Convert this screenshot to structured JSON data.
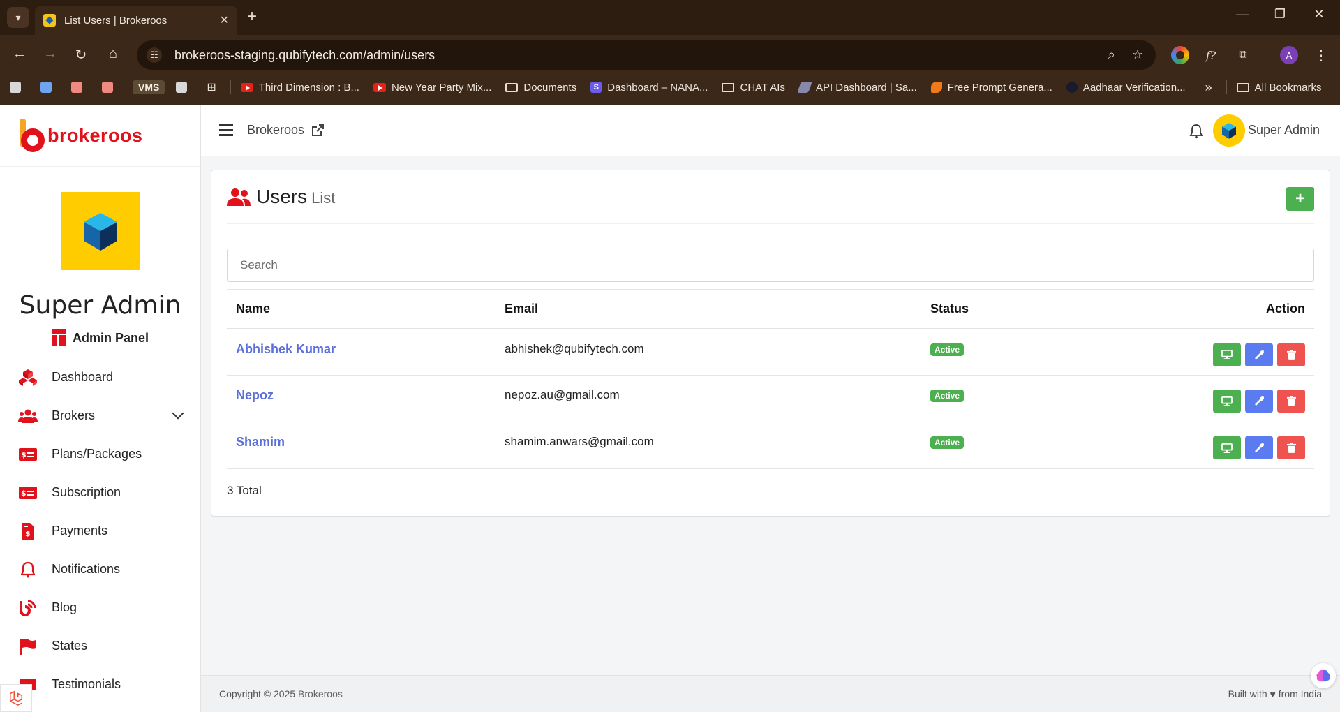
{
  "browser": {
    "tab_title": "List Users | Brokeroos",
    "url": "brokeroos-staging.qubifytech.com/admin/users",
    "profile_initial": "A",
    "bookmarks": [
      {
        "label": "VMS"
      },
      {
        "label": "Third Dimension : B..."
      },
      {
        "label": "New Year Party Mix..."
      },
      {
        "label": "Documents"
      },
      {
        "label": "Dashboard – NANA..."
      },
      {
        "label": "CHAT AIs"
      },
      {
        "label": "API Dashboard | Sa..."
      },
      {
        "label": "Free Prompt Genera..."
      },
      {
        "label": "Aadhaar Verification..."
      },
      {
        "label": "All Bookmarks"
      }
    ]
  },
  "sidebar": {
    "brand": "brokeroos",
    "profile_name": "Super Admin",
    "panel_label": "Admin Panel",
    "items": [
      {
        "label": "Dashboard"
      },
      {
        "label": "Brokers"
      },
      {
        "label": "Plans/Packages"
      },
      {
        "label": "Subscription"
      },
      {
        "label": "Payments"
      },
      {
        "label": "Notifications"
      },
      {
        "label": "Blog"
      },
      {
        "label": "States"
      },
      {
        "label": "Testimonials"
      }
    ]
  },
  "header": {
    "site_link": "Brokeroos",
    "user_name": "Super Admin"
  },
  "card": {
    "title": "Users",
    "subtitle": "List",
    "add_label": "+",
    "search_placeholder": "Search",
    "columns": [
      "Name",
      "Email",
      "Status",
      "Action"
    ],
    "rows": [
      {
        "name": "Abhishek Kumar",
        "email": "abhishek@qubifytech.com",
        "status": "Active"
      },
      {
        "name": "Nepoz",
        "email": "nepoz.au@gmail.com",
        "status": "Active"
      },
      {
        "name": "Shamim",
        "email": "shamim.anwars@gmail.com",
        "status": "Active"
      }
    ],
    "total": "3 Total"
  },
  "footer": {
    "copyright_prefix": "Copyright © 2025",
    "copyright_brand": "Brokeroos",
    "built_with": "Built with ♥ from India"
  },
  "colors": {
    "brand_red": "#e0121b",
    "brand_yellow": "#ffcc00",
    "link_blue": "#5a6fd8",
    "success_green": "#4caf50",
    "edit_blue": "#5b7bf0",
    "danger_red": "#ef5350"
  }
}
